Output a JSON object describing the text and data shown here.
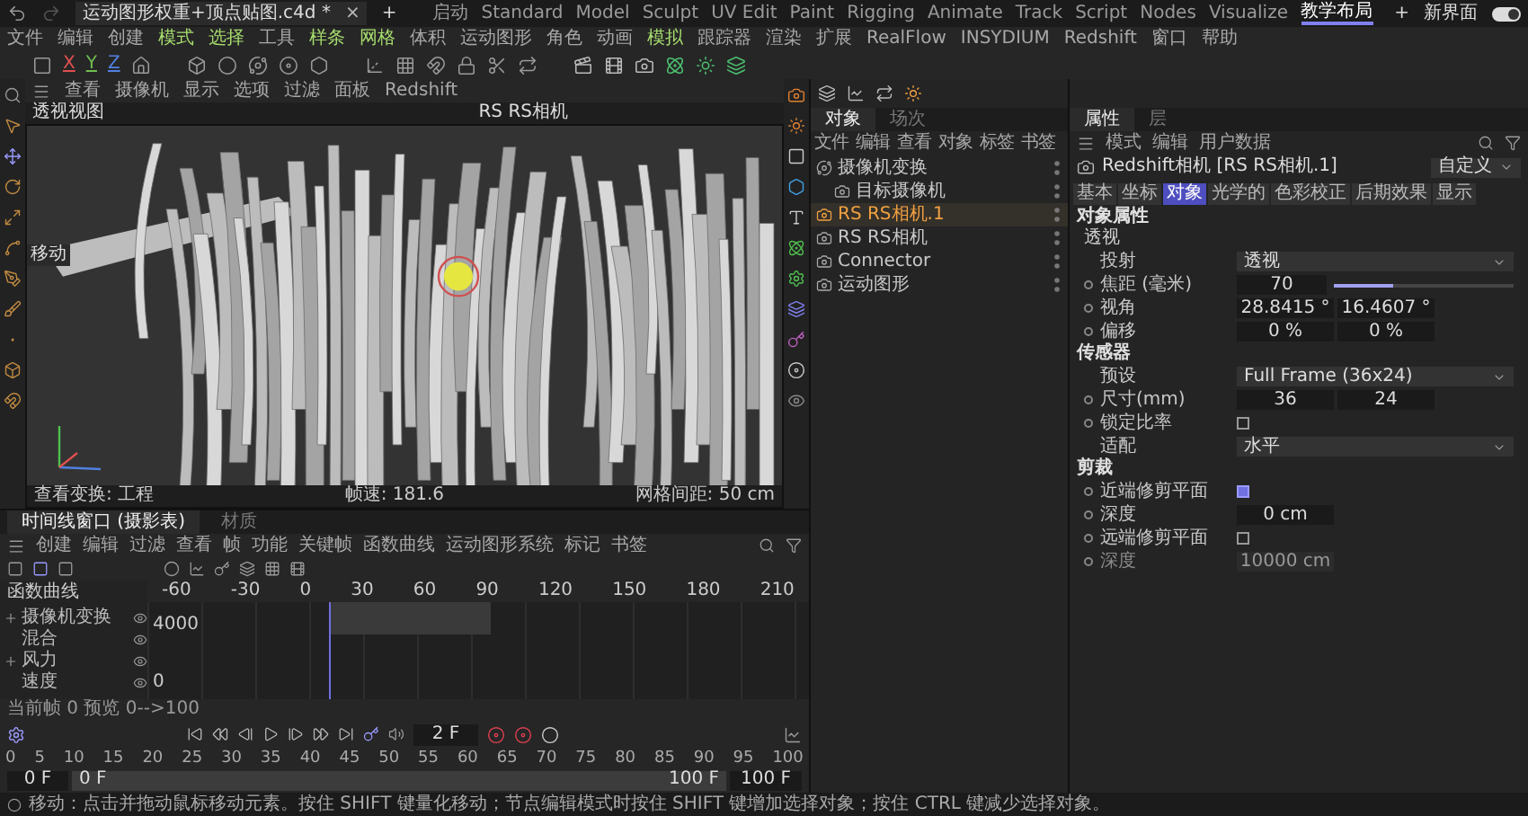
{
  "title_bar": {
    "document_tab": "运动图形权重+顶点贴图.c4d *",
    "close": "×",
    "add": "+",
    "layouts": [
      {
        "label": "启动",
        "selected": false
      },
      {
        "label": "Standard",
        "selected": false
      },
      {
        "label": "Model",
        "selected": false
      },
      {
        "label": "Sculpt",
        "selected": false
      },
      {
        "label": "UV Edit",
        "selected": false
      },
      {
        "label": "Paint",
        "selected": false
      },
      {
        "label": "Rigging",
        "selected": false
      },
      {
        "label": "Animate",
        "selected": false
      },
      {
        "label": "Track",
        "selected": false
      },
      {
        "label": "Script",
        "selected": false
      },
      {
        "label": "Nodes",
        "selected": false
      },
      {
        "label": "Visualize",
        "selected": false
      },
      {
        "label": "教学布局",
        "selected": true
      }
    ],
    "layout_add": "+",
    "new_layout": "新界面",
    "switch_on": true
  },
  "menu_bar": [
    {
      "label": "文件",
      "highlighted": false
    },
    {
      "label": "编辑",
      "highlighted": false
    },
    {
      "label": "创建",
      "highlighted": false
    },
    {
      "label": "模式",
      "highlighted": true
    },
    {
      "label": "选择",
      "highlighted": true
    },
    {
      "label": "工具",
      "highlighted": false
    },
    {
      "label": "样条",
      "highlighted": true
    },
    {
      "label": "网格",
      "highlighted": true
    },
    {
      "label": "体积",
      "highlighted": false
    },
    {
      "label": "运动图形",
      "highlighted": false
    },
    {
      "label": "角色",
      "highlighted": false
    },
    {
      "label": "动画",
      "highlighted": false
    },
    {
      "label": "模拟",
      "highlighted": true
    },
    {
      "label": "跟踪器",
      "highlighted": false
    },
    {
      "label": "渲染",
      "highlighted": false
    },
    {
      "label": "扩展",
      "highlighted": false
    },
    {
      "label": "RealFlow",
      "highlighted": false
    },
    {
      "label": "INSYDIUM",
      "highlighted": false
    },
    {
      "label": "Redshift",
      "highlighted": false
    },
    {
      "label": "窗口",
      "highlighted": false
    },
    {
      "label": "帮助",
      "highlighted": false
    }
  ],
  "toolbar": {
    "axes": [
      {
        "label": "X",
        "color": "#e05050"
      },
      {
        "label": "Y",
        "color": "#70c050"
      },
      {
        "label": "Z",
        "color": "#5080e0"
      }
    ]
  },
  "viewport": {
    "menu": [
      "查看",
      "摄像机",
      "显示",
      "选项",
      "过滤",
      "面板",
      "Redshift"
    ],
    "view_name": "透视视图",
    "camera": "RS RS相机",
    "tool_label": "移动",
    "view_transform": "查看变换: 工程",
    "fps": "帧速: 181.6",
    "grid": "网格间距: 50 cm"
  },
  "object_manager": {
    "tabs": [
      {
        "label": "对象",
        "selected": true
      },
      {
        "label": "场次",
        "selected": false
      }
    ],
    "menu": [
      "文件",
      "编辑",
      "查看",
      "对象",
      "标签",
      "书签"
    ],
    "objects": [
      {
        "name": "摄像机变换",
        "selected": false,
        "children": [
          {
            "name": "目标摄像机",
            "selected": false
          }
        ]
      },
      {
        "name": "RS RS相机.1",
        "selected": true
      },
      {
        "name": "RS RS相机",
        "selected": false
      },
      {
        "name": "Connector",
        "selected": false
      },
      {
        "name": "运动图形",
        "selected": false
      }
    ]
  },
  "attributes": {
    "tabs": [
      {
        "label": "属性",
        "selected": true
      },
      {
        "label": "层",
        "selected": false
      }
    ],
    "menu": [
      "模式",
      "编辑",
      "用户数据"
    ],
    "title": "Redshift相机 [RS RS相机.1]",
    "preset": "自定义",
    "sections": [
      {
        "label": "基本",
        "selected": false
      },
      {
        "label": "坐标",
        "selected": false
      },
      {
        "label": "对象",
        "selected": true
      },
      {
        "label": "光学的",
        "selected": false
      },
      {
        "label": "色彩校正",
        "selected": false
      },
      {
        "label": "后期效果",
        "selected": false
      },
      {
        "label": "显示",
        "selected": false
      }
    ],
    "rows": [
      {
        "kind": "heading",
        "label": "对象属性"
      },
      {
        "kind": "subheading",
        "label": "透视"
      },
      {
        "kind": "dropdown",
        "label": "投射",
        "value": "透视",
        "animatable": false
      },
      {
        "kind": "slider",
        "label": "焦距 (毫米)",
        "value": "70",
        "level": 0.33,
        "animatable": true
      },
      {
        "kind": "pair",
        "label": "视角",
        "values": [
          "28.8415 °",
          "16.4607 °"
        ],
        "animatable": true
      },
      {
        "kind": "pair",
        "label": "偏移",
        "values": [
          "0 %",
          "0 %"
        ],
        "animatable": true
      },
      {
        "kind": "heading",
        "label": "传感器"
      },
      {
        "kind": "dropdown",
        "label": "预设",
        "value": "Full Frame (36x24)",
        "animatable": false
      },
      {
        "kind": "pair",
        "label": "尺寸(mm)",
        "values": [
          "36",
          "24"
        ],
        "animatable": true
      },
      {
        "kind": "checkbox",
        "label": "锁定比率",
        "checked": false,
        "animatable": true
      },
      {
        "kind": "dropdown",
        "label": "适配",
        "value": "水平",
        "animatable": false
      },
      {
        "kind": "heading",
        "label": "剪裁"
      },
      {
        "kind": "checkbox",
        "label": "近端修剪平面",
        "checked": true,
        "animatable": true
      },
      {
        "kind": "field",
        "label": "深度",
        "value": "0 cm",
        "disabled": false,
        "animatable": true
      },
      {
        "kind": "checkbox",
        "label": "远端修剪平面",
        "checked": false,
        "animatable": true
      },
      {
        "kind": "field",
        "label": "深度",
        "value": "10000 cm",
        "disabled": true,
        "animatable": true
      }
    ]
  },
  "timeline": {
    "tabs": [
      {
        "label": "时间线窗口 (摄影表)",
        "selected": true
      },
      {
        "label": "材质",
        "selected": false
      }
    ],
    "menu": [
      "创建",
      "编辑",
      "过滤",
      "查看",
      "帧",
      "功能",
      "关键帧",
      "函数曲线",
      "运动图形系统",
      "标记",
      "书签"
    ],
    "ruler": [
      "-60",
      "-30",
      "0",
      "30",
      "60",
      "90",
      "120",
      "150",
      "180",
      "210"
    ],
    "curves_label": "函数曲线",
    "tracks": [
      {
        "name": "摄像机变换",
        "children": [
          {
            "name": "混合"
          }
        ]
      },
      {
        "name": "风力",
        "children": [
          {
            "name": "速度"
          }
        ]
      }
    ],
    "y_labels": [
      "4000",
      "0"
    ],
    "frame_info": "当前帧 0 预览 0-->100",
    "current_frame": "2 F",
    "frame_ruler": [
      "0",
      "5",
      "10",
      "15",
      "20",
      "25",
      "30",
      "35",
      "40",
      "45",
      "50",
      "55",
      "60",
      "65",
      "70",
      "75",
      "80",
      "85",
      "90",
      "95",
      "100"
    ],
    "range_start": "0 F",
    "range_from": "0 F",
    "range_to": "100 F",
    "range_end": "100 F"
  },
  "status_bar": "移动：点击并拖动鼠标移动元素。按住 SHIFT 键量化移动；节点编辑模式时按住 SHIFT 键增加选择对象；按住 CTRL 键减少选择对象。"
}
